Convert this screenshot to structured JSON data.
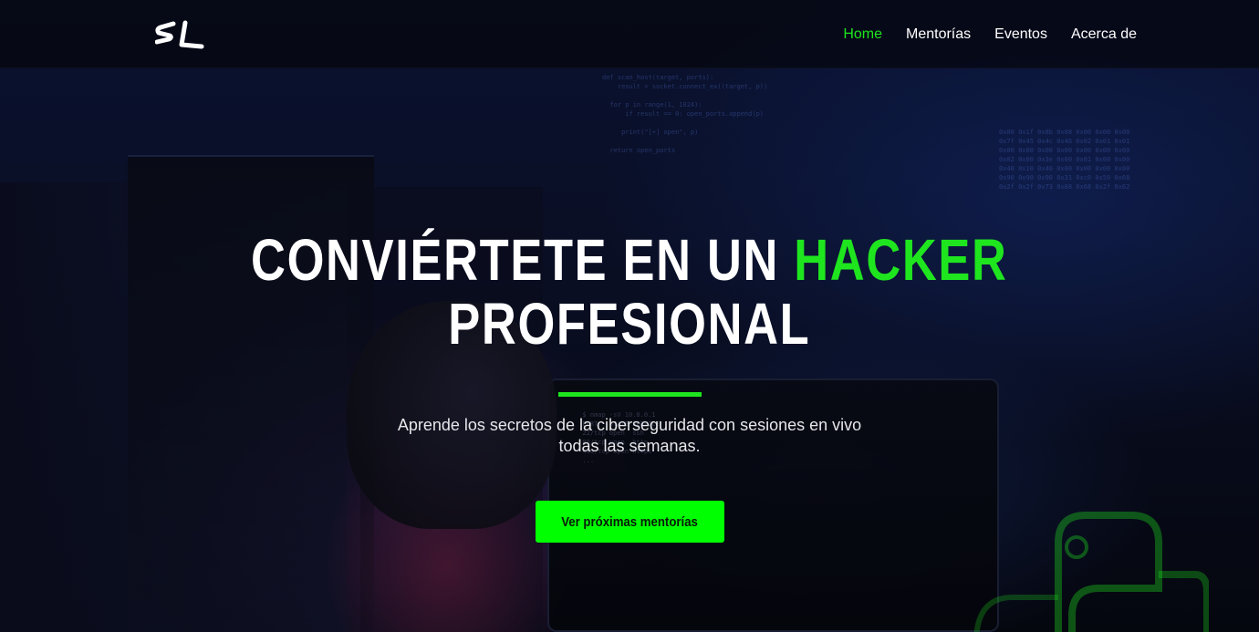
{
  "nav": {
    "logo_text": "SL",
    "links": [
      {
        "label": "Home",
        "active": true
      },
      {
        "label": "Mentorías",
        "active": false
      },
      {
        "label": "Eventos",
        "active": false
      },
      {
        "label": "Acerca de",
        "active": false
      }
    ]
  },
  "hero": {
    "headline_part1": "CONVIÉRTETE EN UN",
    "headline_accent": "HACKER",
    "headline_part2": "PROFESIONAL",
    "subtitle": "Aprende los secretos de la ciberseguridad con sesiones en vivo todas las semanas.",
    "cta_label": "Ver próximas mentorías"
  },
  "colors": {
    "accent": "#1fe51f",
    "cta_background": "#00ff00",
    "text": "#ffffff"
  },
  "icons": {
    "logo": "sl-logo",
    "background_badge": "python-logo-icon"
  }
}
